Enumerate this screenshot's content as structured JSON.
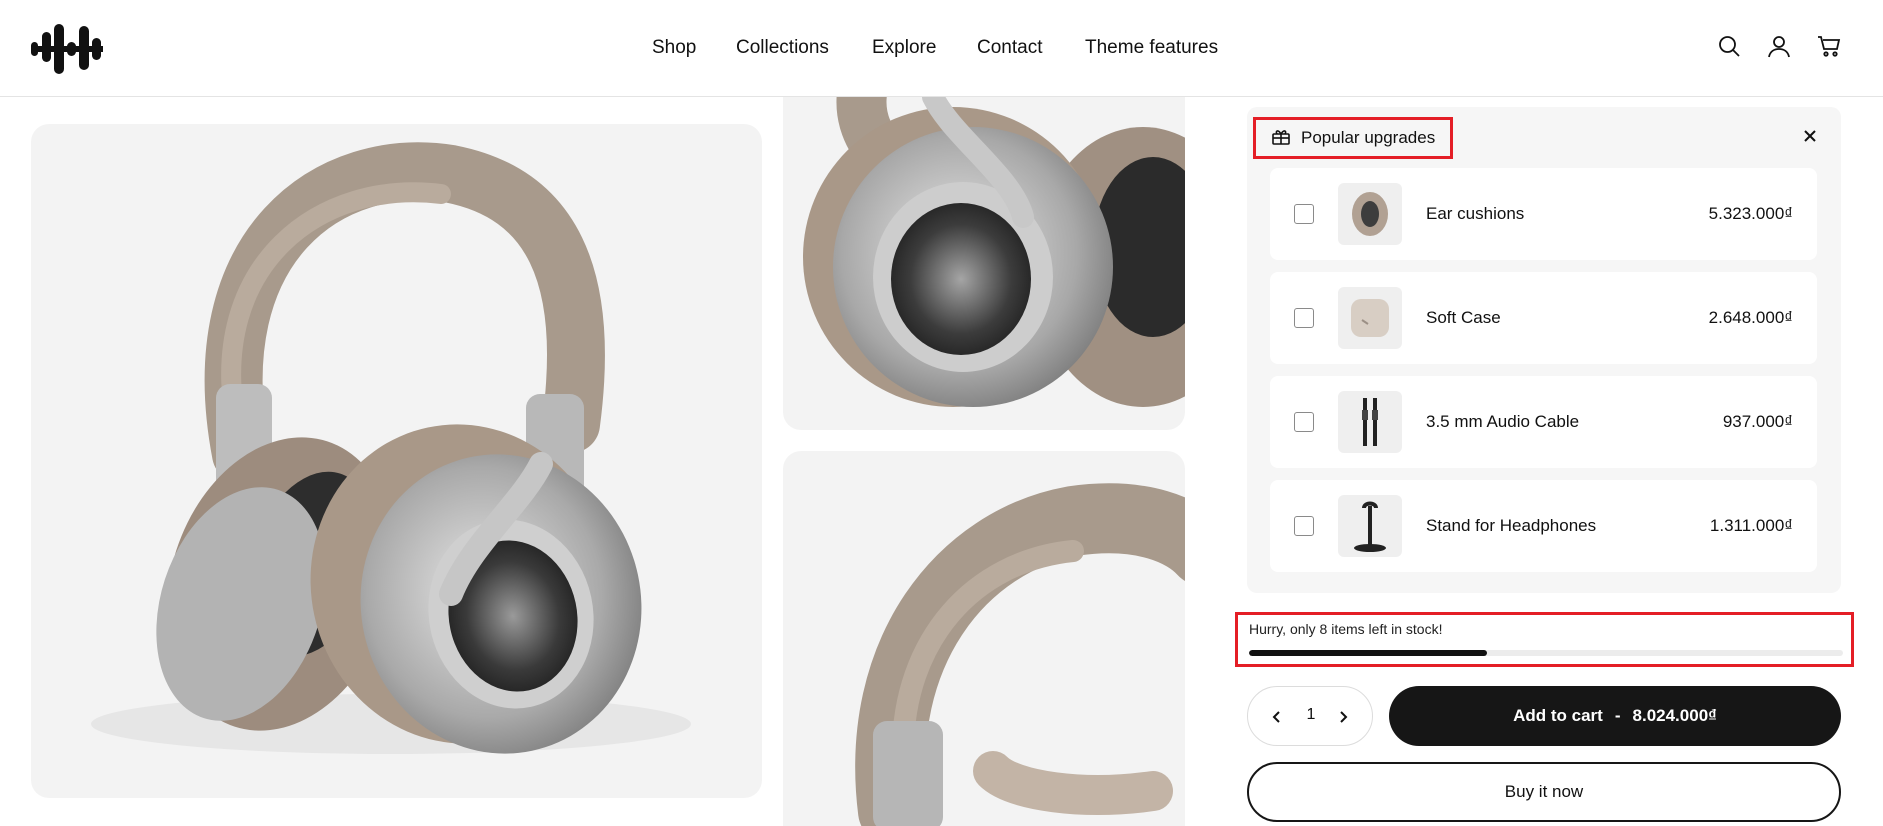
{
  "header": {
    "logo_icon": "waveform-logo-icon",
    "nav": [
      "Shop",
      "Collections",
      "Explore",
      "Contact",
      "Theme features"
    ],
    "icons": [
      "search-icon",
      "account-icon",
      "cart-icon"
    ]
  },
  "gallery": {
    "images": [
      "headphones-main-image",
      "headphones-earcup-image",
      "headphones-headband-image"
    ]
  },
  "upgrades": {
    "title": "Popular upgrades",
    "icon": "gift-icon",
    "close_icon": "close-icon",
    "items": [
      {
        "name": "Ear cushions",
        "price": "5.323.000₫",
        "icon": "ear-cushion-thumb"
      },
      {
        "name": "Soft Case",
        "price": "2.648.000₫",
        "icon": "soft-case-thumb"
      },
      {
        "name": "3.5 mm Audio Cable",
        "price": "937.000₫",
        "icon": "audio-cable-thumb"
      },
      {
        "name": "Stand for Headphones",
        "price": "1.311.000₫",
        "icon": "headphone-stand-thumb"
      }
    ]
  },
  "stock": {
    "message": "Hurry, only 8 items left in stock!",
    "progress": 0.4
  },
  "purchase": {
    "quantity": "1",
    "add_to_cart_label": "Add to cart",
    "separator": "-",
    "total_price": "8.024.000₫",
    "buy_now_label": "Buy it now"
  },
  "colors": {
    "accent_dark": "#161616",
    "highlight_box": "#e41e26",
    "panel_bg": "#f6f6f6"
  }
}
